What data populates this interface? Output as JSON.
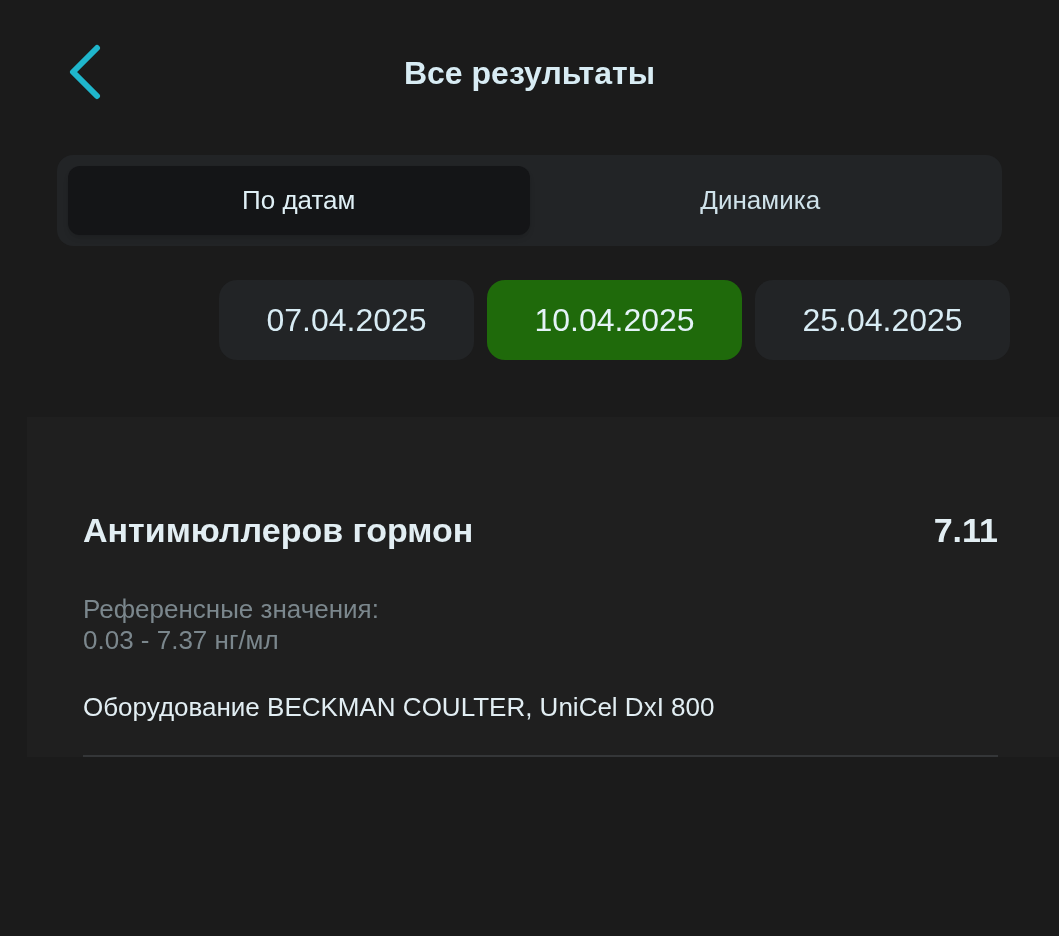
{
  "header": {
    "title": "Все результаты"
  },
  "tabs": [
    {
      "label": "По датам",
      "selected": true
    },
    {
      "label": "Динамика",
      "selected": false
    }
  ],
  "dates": [
    {
      "label": "07.04.2025",
      "selected": false
    },
    {
      "label": "10.04.2025",
      "selected": true
    },
    {
      "label": "25.04.2025",
      "selected": false
    }
  ],
  "results": [
    {
      "name": "Антимюллеров гормон",
      "value": "7.11",
      "reference_label": "Референсные значения:",
      "reference_range": "0.03 - 7.37 нг/мл",
      "equipment": "Оборудование BECKMAN COULTER, UniCel DxI 800"
    }
  ]
}
